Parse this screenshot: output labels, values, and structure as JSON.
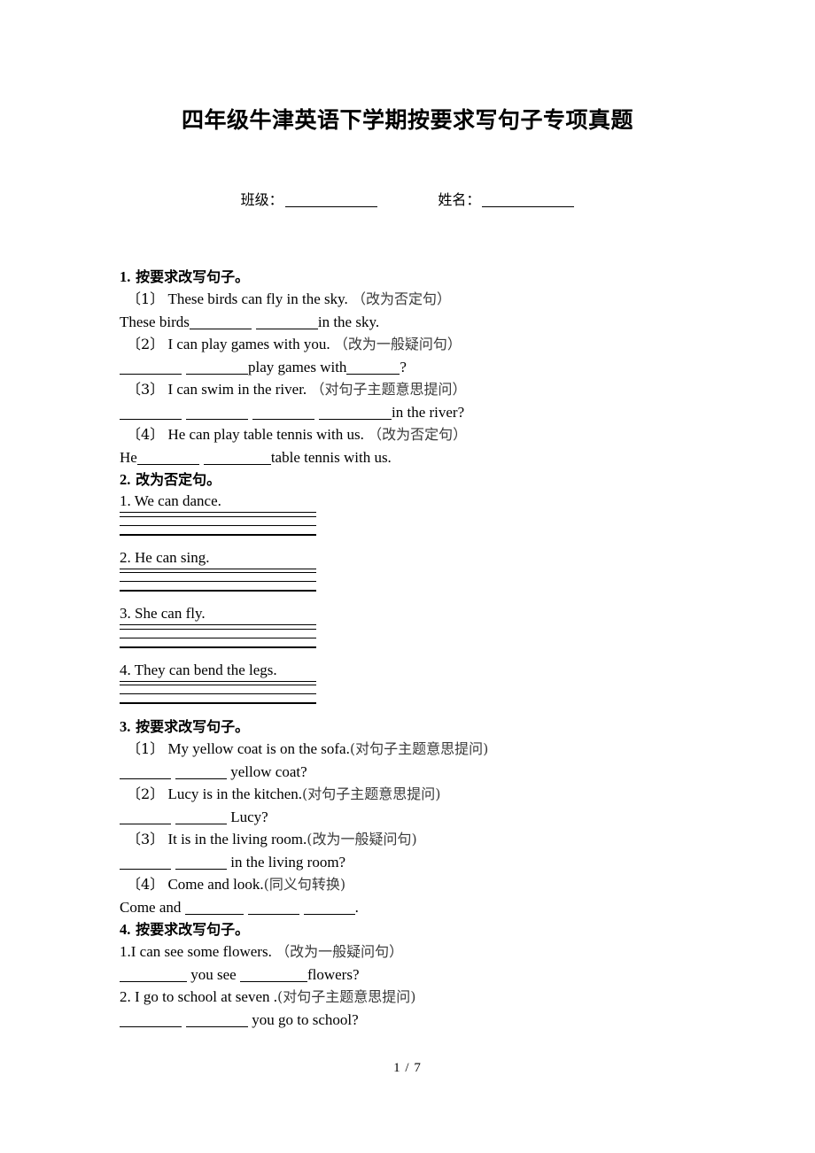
{
  "document": {
    "title": "四年级牛津英语下学期按要求写句子专项真题",
    "class_label": "班级：",
    "name_label": "姓名：",
    "footer": "1 / 7"
  },
  "sections": [
    {
      "number": "1.",
      "heading": "按要求改写句子。",
      "items": [
        {
          "marker": "〔1〕",
          "sentence": "These birds can fly in the sky.",
          "instruction": "（改为否定句）",
          "answer_prefix": "These birds",
          "answer_suffix": "in the sky."
        },
        {
          "marker": "〔2〕",
          "sentence": "I can play games with you.",
          "instruction": "（改为一般疑问句）",
          "answer_middle": "play games with",
          "answer_suffix": "?"
        },
        {
          "marker": "〔3〕",
          "sentence": "I can swim in the river.",
          "instruction": "（对句子主题意思提问）",
          "answer_suffix": "in the river?"
        },
        {
          "marker": "〔4〕",
          "sentence": "He can play table tennis with us.",
          "instruction": "（改为否定句）",
          "answer_prefix": "He",
          "answer_suffix": "table tennis with us."
        }
      ]
    },
    {
      "number": "2.",
      "heading": "改为否定句。",
      "items": [
        {
          "sentence": "1. We can dance."
        },
        {
          "sentence": "2. He can sing."
        },
        {
          "sentence": "3. She can fly."
        },
        {
          "sentence": "4. They can bend the legs."
        }
      ]
    },
    {
      "number": "3.",
      "heading": "按要求改写句子。",
      "items": [
        {
          "marker": "〔1〕",
          "sentence": "My yellow coat is on the sofa.",
          "instruction": "(对句子主题意思提问)",
          "answer_suffix": "yellow coat?"
        },
        {
          "marker": "〔2〕",
          "sentence": "Lucy is in the kitchen.",
          "instruction": "(对句子主题意思提问)",
          "answer_suffix": "Lucy?"
        },
        {
          "marker": "〔3〕",
          "sentence": "It is in the living room.",
          "instruction": "(改为一般疑问句)",
          "answer_suffix": "in the living room?"
        },
        {
          "marker": "〔4〕",
          "sentence": "Come and look.",
          "instruction": "(同义句转换)",
          "answer_prefix": "Come and",
          "answer_suffix": "."
        }
      ]
    },
    {
      "number": "4.",
      "heading": "按要求改写句子。",
      "items": [
        {
          "sentence": "1.I can see some flowers.",
          "instruction": "（改为一般疑问句）",
          "answer_middle": "you  see",
          "answer_suffix": "flowers?"
        },
        {
          "sentence": "2. I go to school at seven .",
          "instruction": "(对句子主题意思提问)",
          "answer_suffix": "you go to school?"
        }
      ]
    }
  ]
}
